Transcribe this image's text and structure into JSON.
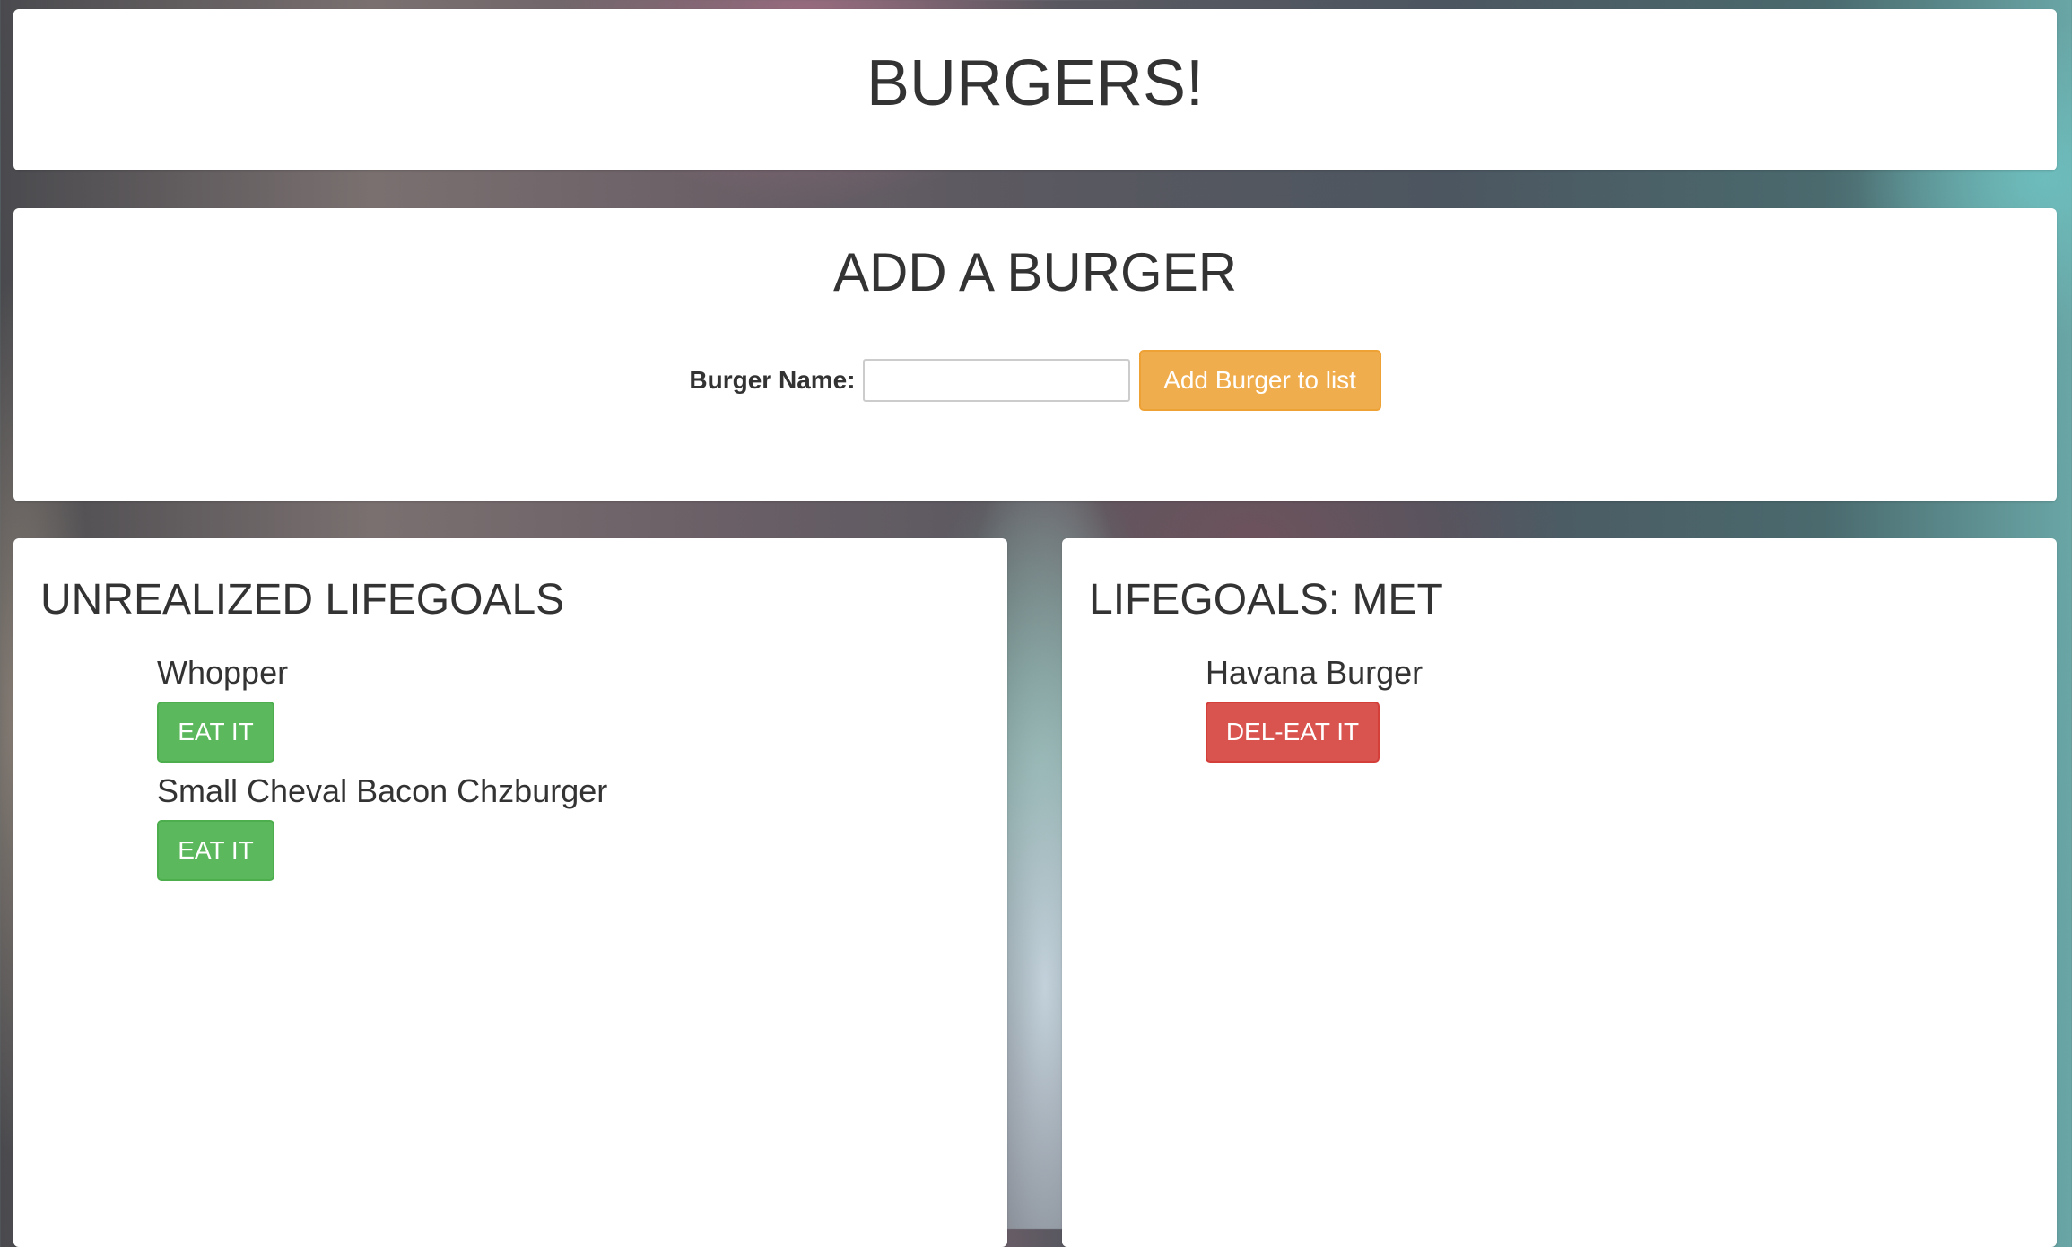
{
  "header": {
    "title": "BURGERS!"
  },
  "add_form": {
    "title": "ADD A BURGER",
    "label": "Burger Name:",
    "input_value": "",
    "button_label": "Add Burger to list"
  },
  "unrealized": {
    "title": "UNREALIZED LIFEGOALS",
    "items": [
      {
        "name": "Whopper",
        "button_label": "EAT IT"
      },
      {
        "name": "Small Cheval Bacon Chzburger",
        "button_label": "EAT IT"
      }
    ]
  },
  "met": {
    "title": "LIFEGOALS: MET",
    "items": [
      {
        "name": "Havana Burger",
        "button_label": "DEL-EAT IT"
      }
    ]
  },
  "colors": {
    "eat_button": "#5cb85c",
    "delete_button": "#d9534f",
    "add_button": "#f0ad4e",
    "text": "#333333"
  }
}
